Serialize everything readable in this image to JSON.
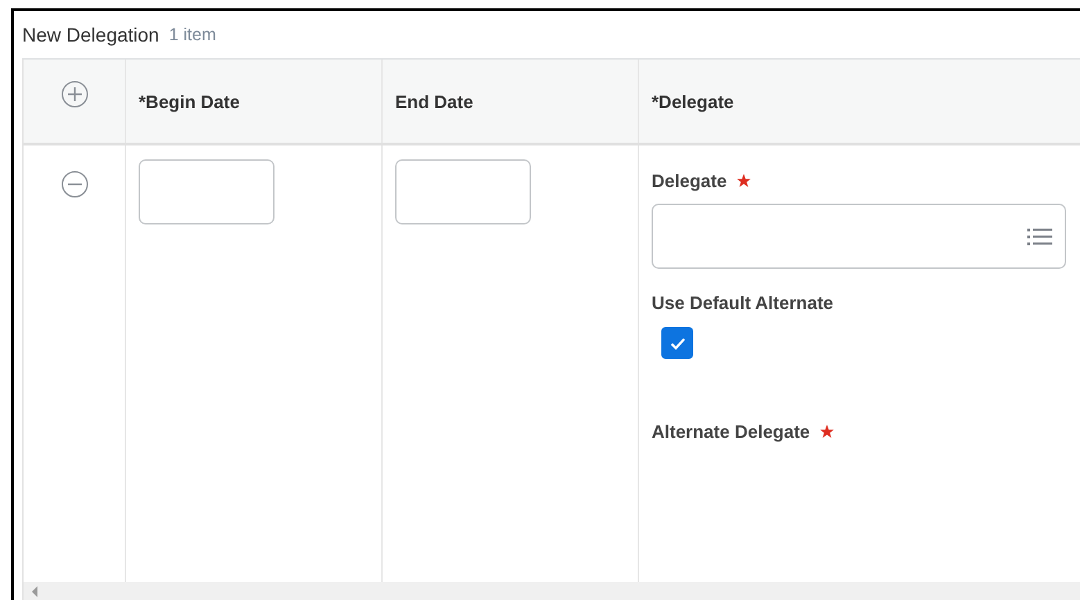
{
  "section": {
    "title": "New Delegation",
    "count": "1 item"
  },
  "columns": [
    {
      "label": "*Begin Date"
    },
    {
      "label": "End Date"
    },
    {
      "label": "*Delegate"
    }
  ],
  "row": {
    "fields": [
      {
        "kind": "prompt",
        "label": "Delegate",
        "required": true
      },
      {
        "kind": "checkbox",
        "label": "Use Default Alternate",
        "checked": true
      },
      {
        "kind": "label",
        "label": "Alternate Delegate",
        "required": true
      }
    ]
  }
}
